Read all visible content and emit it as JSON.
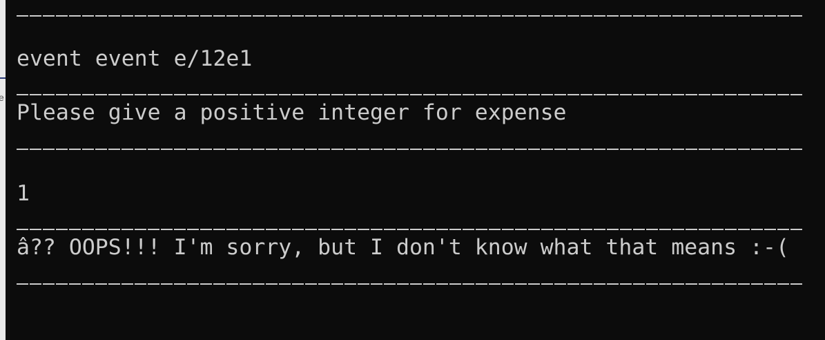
{
  "left_strip": {
    "fragment_char": "e"
  },
  "terminal": {
    "lines": [
      "event event e/12e1",
      "Please give a positive integer for expense",
      "1",
      "â?? OOPS!!! I'm sorry, but I don't know what that means :-("
    ]
  },
  "colors": {
    "background": "#0c0c0c",
    "foreground": "#cccccc"
  }
}
